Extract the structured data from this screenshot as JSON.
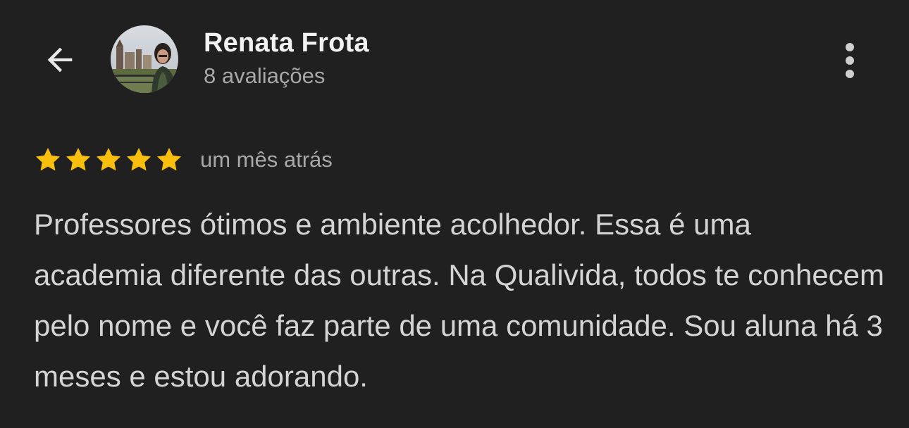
{
  "header": {
    "back_icon": "arrow-back-icon",
    "reviewer_name": "Renata Frota",
    "review_count": "8 avaliações",
    "more_icon": "more-vert-icon"
  },
  "review": {
    "rating": 5,
    "max_rating": 5,
    "star_color": "#F9BF0C",
    "time_ago": "um mês atrás",
    "text": "Professores ótimos e ambiente acolhedor. Essa é uma academia diferente das outras. Na Qualivida, todos te conhecem pelo nome e você faz parte de uma comunidade. Sou aluna há 3 meses e estou adorando."
  },
  "colors": {
    "background": "#202020",
    "name": "#F2F2F2",
    "secondary_text": "#A8A8A8",
    "body_text": "#D4D4D4"
  }
}
